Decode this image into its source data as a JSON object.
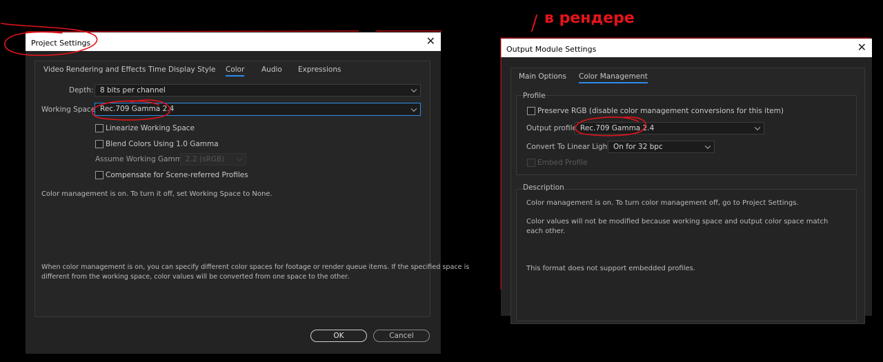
{
  "annotation": {
    "text": "в рендере",
    "color": "#e4141b"
  },
  "project_settings": {
    "title": "Project Settings",
    "close_glyph": "✕",
    "tabs": [
      "Video Rendering and Effects",
      "Time Display Style",
      "Color",
      "Audio",
      "Expressions"
    ],
    "active_tab": "Color",
    "depth_label": "Depth:",
    "depth_value": "8 bits per channel",
    "working_space_label": "Working Space:",
    "working_space_value": "Rec.709 Gamma 2.4",
    "linearize_label": "Linearize Working Space",
    "linearize_checked": false,
    "blend_label": "Blend Colors Using 1.0 Gamma",
    "blend_checked": false,
    "assume_gamma_label": "Assume Working Gamma:",
    "assume_gamma_value": "2.2 (sRGB)",
    "compensate_label": "Compensate for Scene-referred Profiles",
    "compensate_checked": false,
    "status_text": "Color management is on. To turn it off, set Working Space to None.",
    "help_text_1": "When color management is on, you can specify different color spaces for footage or render queue items. If the specified space is",
    "help_text_2": "different from the working space, color values will be converted from one space to the other.",
    "ok_label": "OK",
    "cancel_label": "Cancel"
  },
  "output_module": {
    "title": "Output Module Settings",
    "close_glyph": "✕",
    "tabs": [
      "Main Options",
      "Color Management"
    ],
    "active_tab": "Color Management",
    "profile_section": "Profile",
    "preserve_label": "Preserve RGB (disable color management conversions for this item)",
    "preserve_checked": false,
    "output_profile_label": "Output profile:",
    "output_profile_value": "Rec.709 Gamma 2.4",
    "convert_label": "Convert To Linear Light:",
    "convert_value": "On for 32 bpc",
    "embed_label": "Embed Profile",
    "description_section": "Description",
    "desc_1": "Color management is on. To turn color management off, go to Project Settings.",
    "desc_2a": "Color values will not be modified because working space and output color space match",
    "desc_2b": "each other.",
    "desc_3": "This format does not support embedded profiles."
  }
}
